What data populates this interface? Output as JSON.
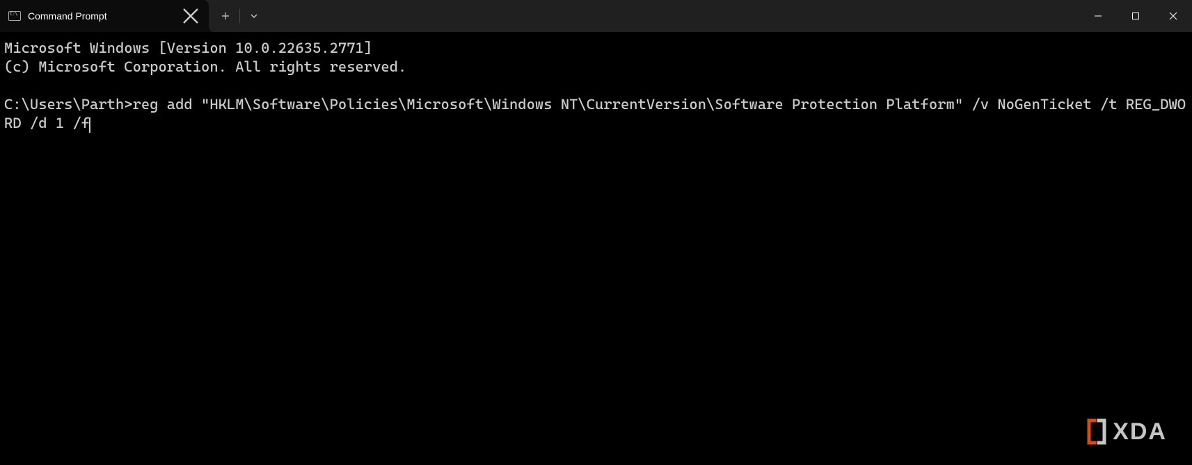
{
  "titlebar": {
    "tab_title": "Command Prompt"
  },
  "terminal": {
    "banner_line1": "Microsoft Windows [Version 10.0.22635.2771]",
    "banner_line2": "(c) Microsoft Corporation. All rights reserved.",
    "prompt": "C:\\Users\\Parth>",
    "command": "reg add \"HKLM\\Software\\Policies\\Microsoft\\Windows NT\\CurrentVersion\\Software Protection Platform\" /v NoGenTicket /t REG_DWORD /d 1 /f"
  },
  "watermark": {
    "text": "XDA"
  }
}
